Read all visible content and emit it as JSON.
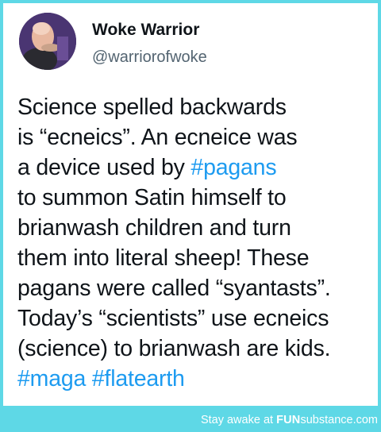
{
  "author": {
    "display_name": "Woke Warrior",
    "handle": "@warriorofwoke",
    "avatar_icon": "profile-photo-avatar"
  },
  "tweet": {
    "lines": [
      {
        "text": "Science spelled backwards"
      },
      {
        "text": "is “ecneics”. An ecneice was"
      },
      {
        "before": "a device used by ",
        "hashtag": "#pagans"
      },
      {
        "text": "to summon Satin himself to"
      },
      {
        "text": "brianwash children and turn"
      },
      {
        "text": "them into literal sheep! These"
      },
      {
        "text": "pagans were called “syantasts”."
      },
      {
        "text": "Today’s “scientists” use ecneics"
      },
      {
        "text": "(science) to brianwash are kids."
      },
      {
        "hashtag_a": "#maga",
        "hashtag_b": "#flatearth"
      }
    ]
  },
  "footer": {
    "prefix": "Stay awake at ",
    "brand_a": "FUN",
    "brand_b": "substance",
    "brand_c": ".com"
  },
  "colors": {
    "frame": "#5ed8e6",
    "hashtag": "#1d9bf0",
    "text": "#0f1419",
    "handle": "#536471"
  }
}
